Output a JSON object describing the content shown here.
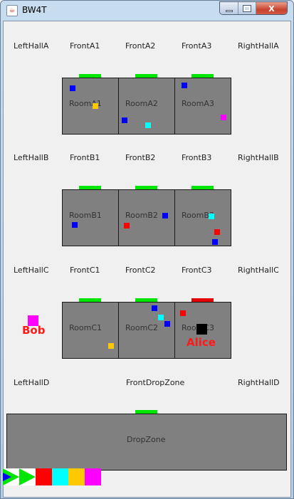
{
  "window": {
    "title": "BW4T",
    "icon": "java-cup-icon",
    "controls": [
      "minimize",
      "maximize",
      "close"
    ],
    "close_glyph": "X"
  },
  "colors": {
    "room": "#808080",
    "door_open": "#00e600",
    "door_occupied": "#e60000",
    "blue": "#0000ff",
    "orange": "#ffc800",
    "magenta": "#ff00ff",
    "cyan": "#00ffff",
    "red": "#ff0000",
    "bot_label": "#ff1a1a"
  },
  "labels": {
    "row_a": [
      "LeftHallA",
      "FrontA1",
      "FrontA2",
      "FrontA3",
      "RightHallA"
    ],
    "row_b": [
      "LeftHallB",
      "FrontB1",
      "FrontB2",
      "FrontB3",
      "RightHallB"
    ],
    "row_c": [
      "LeftHallC",
      "FrontC1",
      "FrontC2",
      "FrontC3",
      "RightHallC"
    ],
    "row_d": [
      "LeftHallD",
      "FrontDropZone",
      "RightHallD"
    ]
  },
  "rooms": {
    "a1": {
      "name": "RoomA1",
      "door": "open",
      "blocks": [
        "blue",
        "orange"
      ]
    },
    "a2": {
      "name": "RoomA2",
      "door": "open",
      "blocks": [
        "blue",
        "cyan"
      ]
    },
    "a3": {
      "name": "RoomA3",
      "door": "open",
      "blocks": [
        "blue",
        "magenta"
      ]
    },
    "b1": {
      "name": "RoomB1",
      "door": "open",
      "blocks": [
        "blue"
      ]
    },
    "b2": {
      "name": "RoomB2",
      "door": "open",
      "blocks": [
        "red",
        "blue"
      ]
    },
    "b3": {
      "name": "RoomB3",
      "door": "open",
      "blocks": [
        "cyan",
        "red",
        "blue"
      ]
    },
    "c1": {
      "name": "RoomC1",
      "door": "open",
      "blocks": [
        "orange"
      ]
    },
    "c2": {
      "name": "RoomC2",
      "door": "open",
      "blocks": [
        "blue",
        "cyan",
        "blue"
      ]
    },
    "c3": {
      "name": "RoomC3",
      "door": "occupied",
      "blocks": [
        "red"
      ]
    }
  },
  "dropzone": {
    "name": "DropZone",
    "door": "open"
  },
  "bots": [
    {
      "name": "Bob",
      "holding": "magenta"
    },
    {
      "name": "Alice",
      "holding": "none"
    }
  ],
  "sequence": {
    "completed_markers": 2,
    "colors": [
      "red",
      "cyan",
      "orange",
      "magenta"
    ]
  }
}
